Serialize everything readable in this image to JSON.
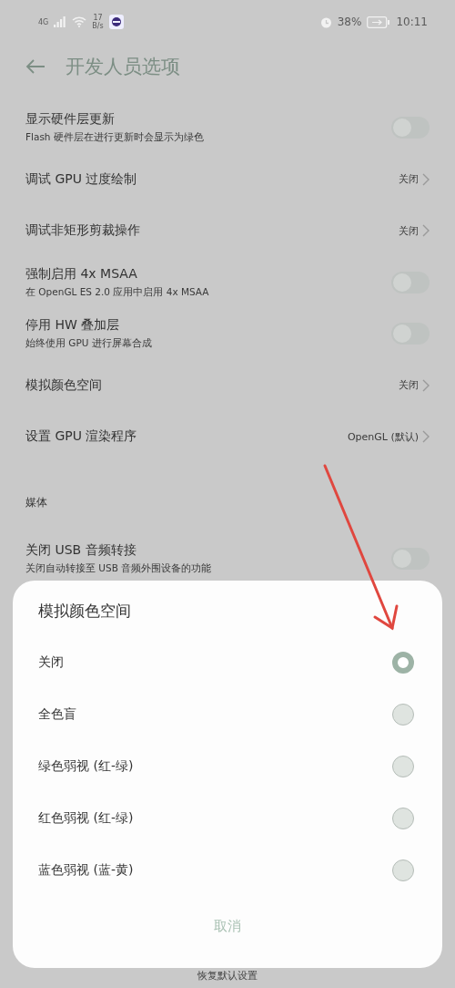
{
  "status_bar": {
    "network_type": "4G",
    "network_speed": "17",
    "speed_unit": "B/s",
    "battery": "38%",
    "time": "10:11"
  },
  "header": {
    "title": "开发人员选项"
  },
  "settings": [
    {
      "kind": "toggle",
      "title": "显示硬件层更新",
      "subtitle": "Flash 硬件层在进行更新时会显示为绿色",
      "on": false
    },
    {
      "kind": "value",
      "title": "调试 GPU 过度绘制",
      "value": "关闭"
    },
    {
      "kind": "value",
      "title": "调试非矩形剪裁操作",
      "value": "关闭"
    },
    {
      "kind": "toggle",
      "title": "强制启用 4x MSAA",
      "subtitle": "在 OpenGL ES 2.0 应用中启用 4x MSAA",
      "on": false
    },
    {
      "kind": "toggle",
      "title": "停用 HW 叠加层",
      "subtitle": "始终使用 GPU 进行屏幕合成",
      "on": false
    },
    {
      "kind": "value",
      "title": "模拟颜色空间",
      "value": "关闭"
    },
    {
      "kind": "value",
      "title": "设置 GPU 渲染程序",
      "value": "OpenGL (默认)"
    },
    {
      "kind": "section",
      "title": "媒体"
    },
    {
      "kind": "toggle",
      "title": "关闭 USB 音频转接",
      "subtitle": "关闭自动转接至 USB 音频外围设备的功能",
      "on": false
    }
  ],
  "footer_link": "恢复默认设置",
  "dialog": {
    "title": "模拟颜色空间",
    "options": [
      {
        "label": "关闭",
        "selected": true
      },
      {
        "label": "全色盲",
        "selected": false
      },
      {
        "label": "绿色弱视 (红-绿)",
        "selected": false
      },
      {
        "label": "红色弱视 (红-绿)",
        "selected": false
      },
      {
        "label": "蓝色弱视 (蓝-黄)",
        "selected": false
      }
    ],
    "cancel": "取消"
  }
}
